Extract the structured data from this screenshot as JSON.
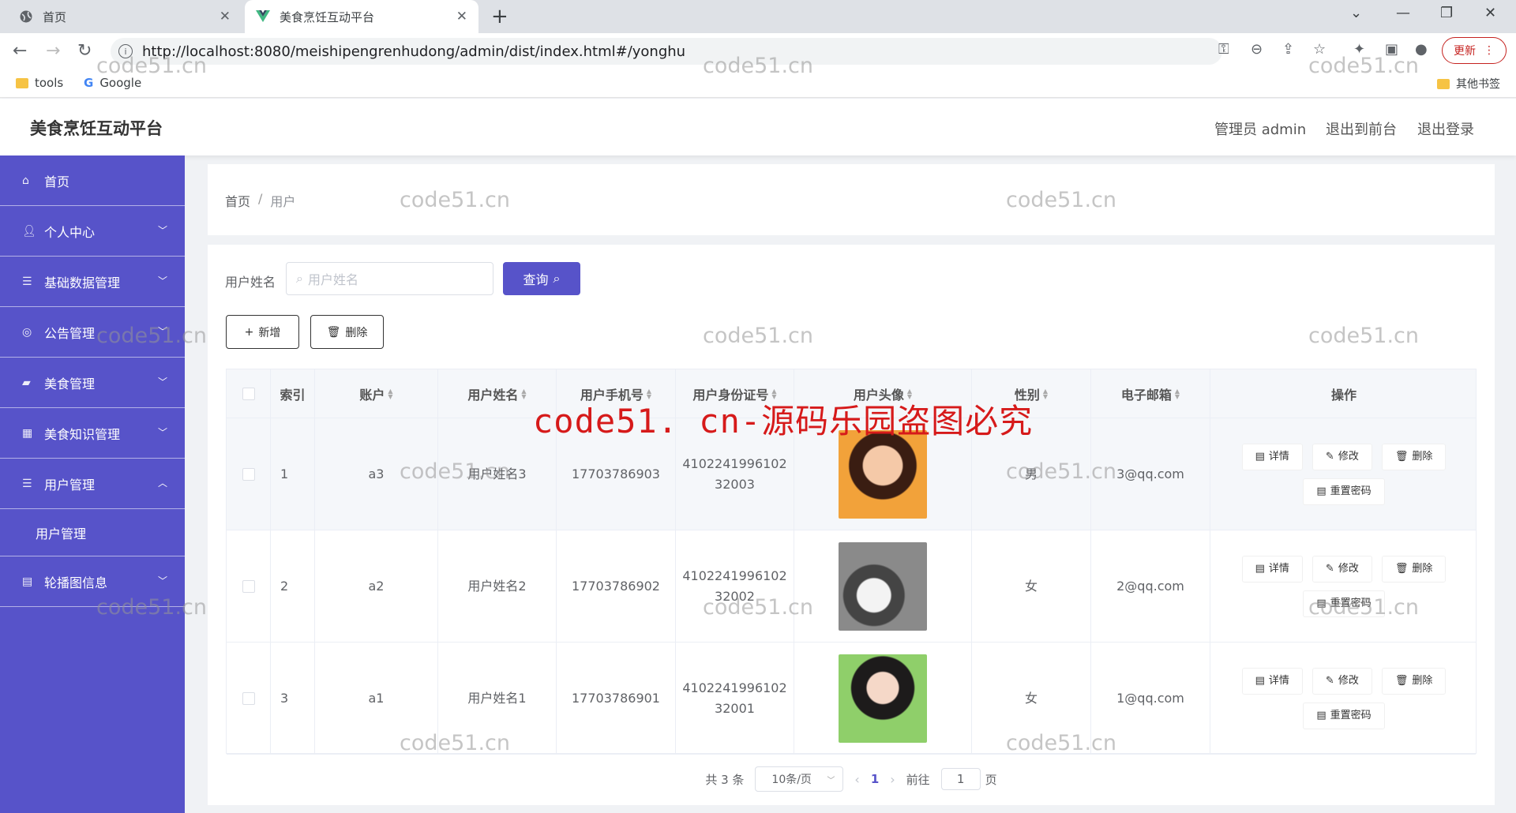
{
  "browser": {
    "tabs": [
      {
        "title": "首页",
        "active": false
      },
      {
        "title": "美食烹饪互动平台",
        "active": true
      }
    ],
    "url": "http://localhost:8080/meishipengrenhudong/admin/dist/index.html#/yonghu",
    "update_label": "更新",
    "bookmarks": [
      "tools",
      "Google"
    ],
    "other_bookmarks": "其他书签"
  },
  "header": {
    "title": "美食烹饪互动平台",
    "links": [
      "管理员 admin",
      "退出到前台",
      "退出登录"
    ]
  },
  "sidebar": {
    "items": [
      {
        "label": "首页",
        "icon": "home-icon"
      },
      {
        "label": "个人中心",
        "icon": "user-icon"
      },
      {
        "label": "基础数据管理",
        "icon": "list-icon"
      },
      {
        "label": "公告管理",
        "icon": "compass-icon"
      },
      {
        "label": "美食管理",
        "icon": "flag-icon"
      },
      {
        "label": "美食知识管理",
        "icon": "grid-icon"
      },
      {
        "label": "用户管理",
        "icon": "list-icon",
        "expanded": true
      },
      {
        "label": "轮播图信息",
        "icon": "doc-icon"
      }
    ],
    "submenu": [
      "用户管理"
    ]
  },
  "breadcrumb": {
    "home": "首页",
    "sep": "/",
    "current": "用户"
  },
  "search": {
    "label": "用户姓名",
    "placeholder": "用户姓名",
    "button": "查询"
  },
  "actions": {
    "add": "新增",
    "delete": "删除"
  },
  "table": {
    "columns": [
      "索引",
      "账户",
      "用户姓名",
      "用户手机号",
      "用户身份证号",
      "用户头像",
      "性别",
      "电子邮箱",
      "操作"
    ],
    "rows": [
      {
        "index": "1",
        "account": "a3",
        "name": "用户姓名3",
        "phone": "17703786903",
        "id_line1": "4102241996102",
        "id_line2": "32003",
        "gender": "男",
        "email": "3@qq.com"
      },
      {
        "index": "2",
        "account": "a2",
        "name": "用户姓名2",
        "phone": "17703786902",
        "id_line1": "4102241996102",
        "id_line2": "32002",
        "gender": "女",
        "email": "2@qq.com"
      },
      {
        "index": "3",
        "account": "a1",
        "name": "用户姓名1",
        "phone": "17703786901",
        "id_line1": "4102241996102",
        "id_line2": "32001",
        "gender": "女",
        "email": "1@qq.com"
      }
    ],
    "ops": {
      "detail": "详情",
      "edit": "修改",
      "delete": "删除",
      "reset": "重置密码"
    }
  },
  "pager": {
    "total": "共 3 条",
    "size": "10条/页",
    "current": "1",
    "goto_prefix": "前往",
    "goto_value": "1",
    "goto_suffix": "页"
  },
  "watermark": {
    "small": "code51.cn",
    "big": "code51. cn-源码乐园盗图必究"
  }
}
